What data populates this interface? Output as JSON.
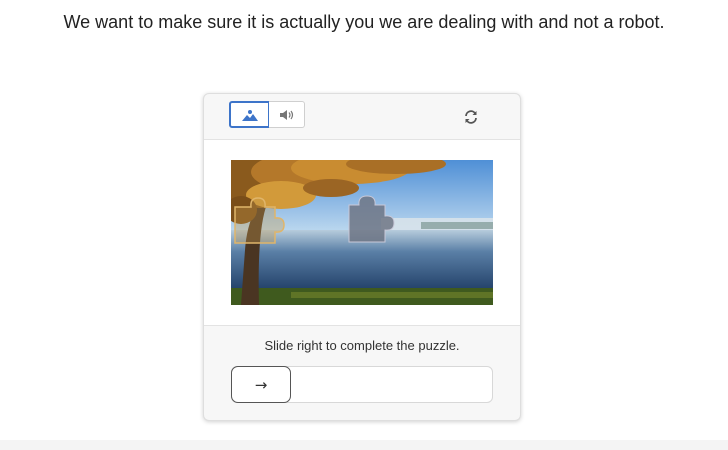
{
  "page": {
    "message": "We want to make sure it is actually you we are dealing with and not a robot."
  },
  "captcha": {
    "modes": {
      "image_icon": "image-mode-icon",
      "audio_icon": "audio-mode-icon",
      "selected": "image"
    },
    "refresh_icon": "refresh-icon",
    "puzzle": {
      "scene": "autumn tree by a misty lake",
      "piece_icon": "puzzle-piece",
      "target_icon": "puzzle-slot"
    },
    "prompt": "Slide right to complete the puzzle.",
    "slider": {
      "handle_glyph": "→",
      "position": 0
    }
  },
  "colors": {
    "accent": "#3d74c9",
    "widget_bg": "#f7f7f7"
  }
}
